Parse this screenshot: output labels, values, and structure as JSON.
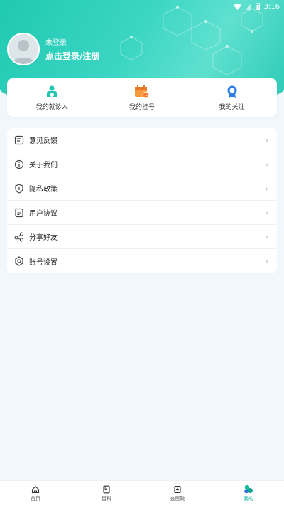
{
  "status_bar": {
    "time": "3:16"
  },
  "profile": {
    "status": "未登录",
    "login_label": "点击登录/注册"
  },
  "quick_actions": [
    {
      "label": "我的就诊人",
      "icon": "patient-icon"
    },
    {
      "label": "我的挂号",
      "icon": "calendar-icon"
    },
    {
      "label": "我的关注",
      "icon": "badge-icon"
    }
  ],
  "menu": [
    {
      "label": "意见反馈",
      "icon": "feedback-icon"
    },
    {
      "label": "关于我们",
      "icon": "info-icon"
    },
    {
      "label": "隐私政策",
      "icon": "shield-icon"
    },
    {
      "label": "用户协议",
      "icon": "document-icon"
    },
    {
      "label": "分享好友",
      "icon": "share-icon"
    },
    {
      "label": "账号设置",
      "icon": "gear-icon"
    }
  ],
  "tabbar": [
    {
      "label": "首页",
      "icon": "home-icon"
    },
    {
      "label": "百科",
      "icon": "book-icon"
    },
    {
      "label": "查医院",
      "icon": "hospital-icon"
    },
    {
      "label": "我的",
      "icon": "profile-icon",
      "active": true
    }
  ],
  "colors": {
    "accent": "#17b9a2",
    "background": "#f1f7fa"
  }
}
